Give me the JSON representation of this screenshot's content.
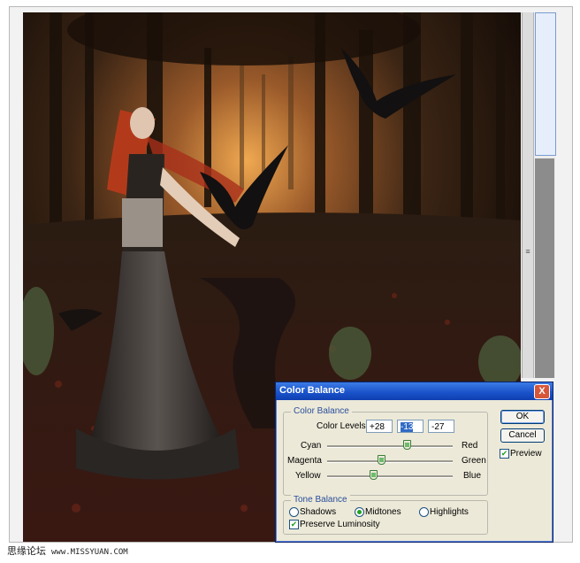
{
  "dialog": {
    "title": "Color Balance",
    "close_label": "X",
    "color_balance_group": "Color Balance",
    "color_levels_label": "Color Levels:",
    "levels": [
      "+28",
      "-13",
      "-27"
    ],
    "sliders": [
      {
        "left": "Cyan",
        "right": "Red",
        "value": 28
      },
      {
        "left": "Magenta",
        "right": "Green",
        "value": -13
      },
      {
        "left": "Yellow",
        "right": "Blue",
        "value": -27
      }
    ],
    "tone_balance_group": "Tone Balance",
    "tone_options": [
      "Shadows",
      "Midtones",
      "Highlights"
    ],
    "tone_selected": "Midtones",
    "preserve_luminosity_label": "Preserve Luminosity",
    "preserve_luminosity_checked": true,
    "ok_label": "OK",
    "cancel_label": "Cancel",
    "preview_label": "Preview",
    "preview_checked": true
  },
  "footer": {
    "site_name": "思缘论坛",
    "url": "www.MISSYUAN.COM"
  },
  "colors": {
    "titlebar": "#1951c8",
    "dialog_bg": "#ece9d8",
    "check_green": "#21a121"
  },
  "icons": {
    "close": "close-icon",
    "panel_grip": "grip-icon"
  }
}
